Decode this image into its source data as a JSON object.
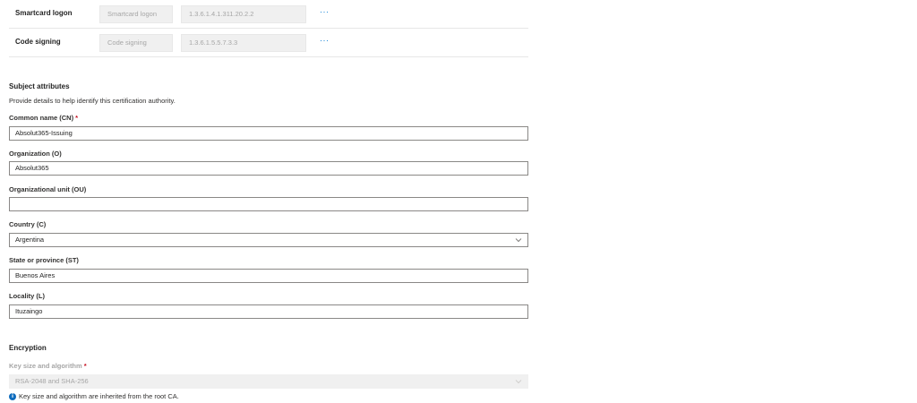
{
  "eku_rows": [
    {
      "name": "Smartcard logon",
      "name_field": "Smartcard logon",
      "oid_field": "1.3.6.1.4.1.311.20.2.2",
      "more": "···"
    },
    {
      "name": "Code signing",
      "name_field": "Code signing",
      "oid_field": "1.3.6.1.5.5.7.3.3",
      "more": "···"
    }
  ],
  "subject": {
    "title": "Subject attributes",
    "description": "Provide details to help identify this certification authority.",
    "common_name": {
      "label": "Common name (CN)",
      "required": "*",
      "value": "Absolut365-Issuing"
    },
    "organization": {
      "label": "Organization (O)",
      "value": "Absolut365"
    },
    "org_unit": {
      "label": "Organizational unit (OU)",
      "value": ""
    },
    "country": {
      "label": "Country (C)",
      "value": "Argentina"
    },
    "state": {
      "label": "State or province (ST)",
      "value": "Buenos Aires"
    },
    "locality": {
      "label": "Locality (L)",
      "value": "Ituzaingo"
    }
  },
  "encryption": {
    "title": "Encryption",
    "key": {
      "label": "Key size and algorithm",
      "required": "*",
      "value": "RSA-2048 and SHA-256"
    },
    "info": "Key size and algorithm are inherited from the root CA.",
    "info_icon_glyph": "i"
  },
  "colors": {
    "accent": "#0078d4",
    "required": "#c50f1f",
    "info": "#0f6cbd"
  }
}
